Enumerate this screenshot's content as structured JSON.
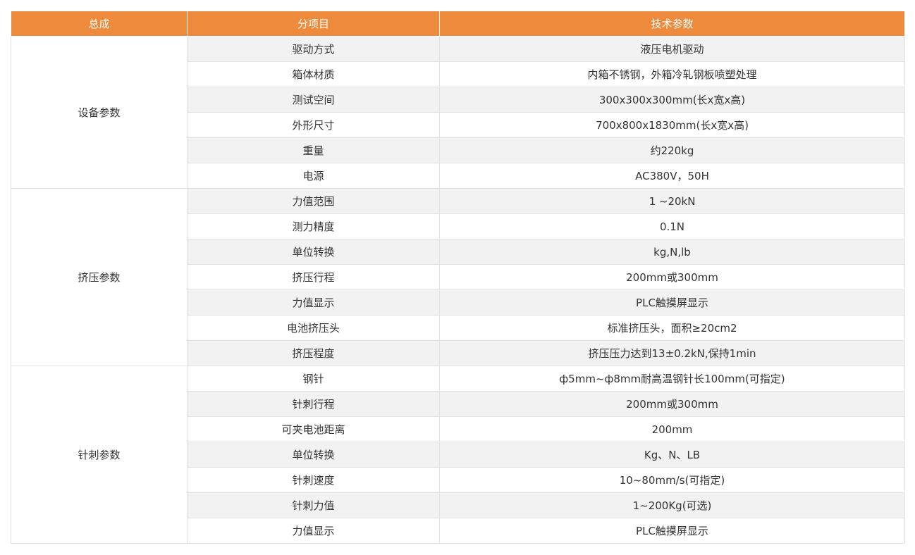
{
  "header": {
    "col1": "总成",
    "col2": "分项目",
    "col3": "技术参数"
  },
  "groups": [
    {
      "name": "设备参数",
      "rows": [
        {
          "item": "驱动方式",
          "value": "液压电机驱动"
        },
        {
          "item": "箱体材质",
          "value": "内箱不锈钢，外箱冷轧钢板喷塑处理"
        },
        {
          "item": "测试空间",
          "value": "300x300x300mm(长x宽x高)"
        },
        {
          "item": "外形尺寸",
          "value": "700x800x1830mm(长x宽x高)"
        },
        {
          "item": "重量",
          "value": "约220kg"
        },
        {
          "item": "电源",
          "value": "AC380V，50H"
        }
      ]
    },
    {
      "name": "挤压参数",
      "rows": [
        {
          "item": "力值范围",
          "value": "1 ~20kN"
        },
        {
          "item": "测力精度",
          "value": "0.1N"
        },
        {
          "item": "单位转换",
          "value": "kg,N,lb"
        },
        {
          "item": "挤压行程",
          "value": "200mm或300mm"
        },
        {
          "item": "力值显示",
          "value": "PLC触摸屏显示"
        },
        {
          "item": "电池挤压头",
          "value": "标准挤压头，面积≥20cm2"
        },
        {
          "item": "挤压程度",
          "value": "挤压压力达到13±0.2kN,保持1min"
        }
      ]
    },
    {
      "name": "针刺参数",
      "rows": [
        {
          "item": "钢针",
          "value": "ф5mm~ф8mm耐高温钢针长100mm(可指定)"
        },
        {
          "item": "针刺行程",
          "value": "200mm或300mm"
        },
        {
          "item": "可夹电池距离",
          "value": "200mm"
        },
        {
          "item": "单位转换",
          "value": "Kg、N、LB"
        },
        {
          "item": "针刺速度",
          "value": "10~80mm/s(可指定)"
        },
        {
          "item": "针刺力值",
          "value": "1~200Kg(可选)"
        },
        {
          "item": "力值显示",
          "value": "PLC触摸屏显示"
        }
      ]
    }
  ],
  "colors": {
    "header_bg": "#ed8a3b",
    "header_text": "#ffffff",
    "stripe_bg": "#f2f2f2",
    "border": "#e2e2e2",
    "text": "#333333"
  }
}
